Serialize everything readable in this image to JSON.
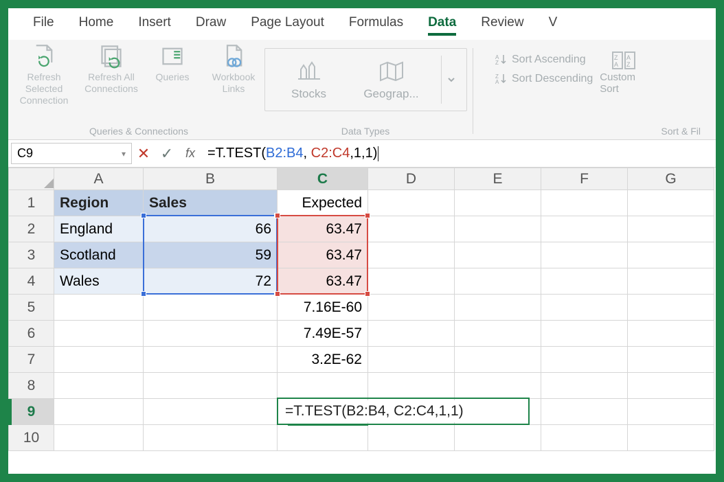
{
  "tabs": {
    "file": "File",
    "home": "Home",
    "insert": "Insert",
    "draw": "Draw",
    "page_layout": "Page Layout",
    "formulas": "Formulas",
    "data": "Data",
    "review": "Review",
    "view_partial": "V"
  },
  "ribbon": {
    "refresh_selected": "Refresh Selected Connection",
    "refresh_all": "Refresh All Connections",
    "queries": "Queries",
    "workbook_links": "Workbook Links",
    "group_queries": "Queries & Connections",
    "stocks": "Stocks",
    "geography": "Geograp...",
    "group_datatypes": "Data Types",
    "sort_asc": "Sort Ascending",
    "sort_desc": "Sort Descending",
    "custom_sort": "Custom Sort",
    "group_sort": "Sort & Fil"
  },
  "name_box": "C9",
  "formula": {
    "prefix": "=T.TEST(",
    "ref1": "B2:B4",
    "sep1": ", ",
    "ref2": "C2:C4",
    "suffix": ",1,1)"
  },
  "columns": [
    "A",
    "B",
    "C",
    "D",
    "E",
    "F",
    "G"
  ],
  "rows": [
    "1",
    "2",
    "3",
    "4",
    "5",
    "6",
    "7",
    "8",
    "9",
    "10"
  ],
  "cells": {
    "A1": "Region",
    "B1": "Sales",
    "C1": "Expected",
    "A2": "England",
    "B2": "66",
    "C2": "63.47",
    "A3": "Scotland",
    "B3": "59",
    "C3": "63.47",
    "A4": "Wales",
    "B4": "72",
    "C4": "63.47",
    "C5": "7.16E-60",
    "C6": "7.49E-57",
    "C7": "3.2E-62"
  },
  "editing_cell_text": "=T.TEST(B2:B4, C2:C4,1,1)",
  "colors": {
    "accent": "#1e8449",
    "ref_blue": "#3a6fd8",
    "ref_red": "#d64b42"
  },
  "chart_data": {
    "type": "table",
    "headers": [
      "Region",
      "Sales",
      "Expected"
    ],
    "rows": [
      [
        "England",
        66,
        63.47
      ],
      [
        "Scotland",
        59,
        63.47
      ],
      [
        "Wales",
        72,
        63.47
      ]
    ],
    "extra_values_C": [
      "7.16E-60",
      "7.49E-57",
      "3.2E-62"
    ],
    "active_cell": "C9",
    "active_formula": "=T.TEST(B2:B4, C2:C4,1,1)"
  }
}
